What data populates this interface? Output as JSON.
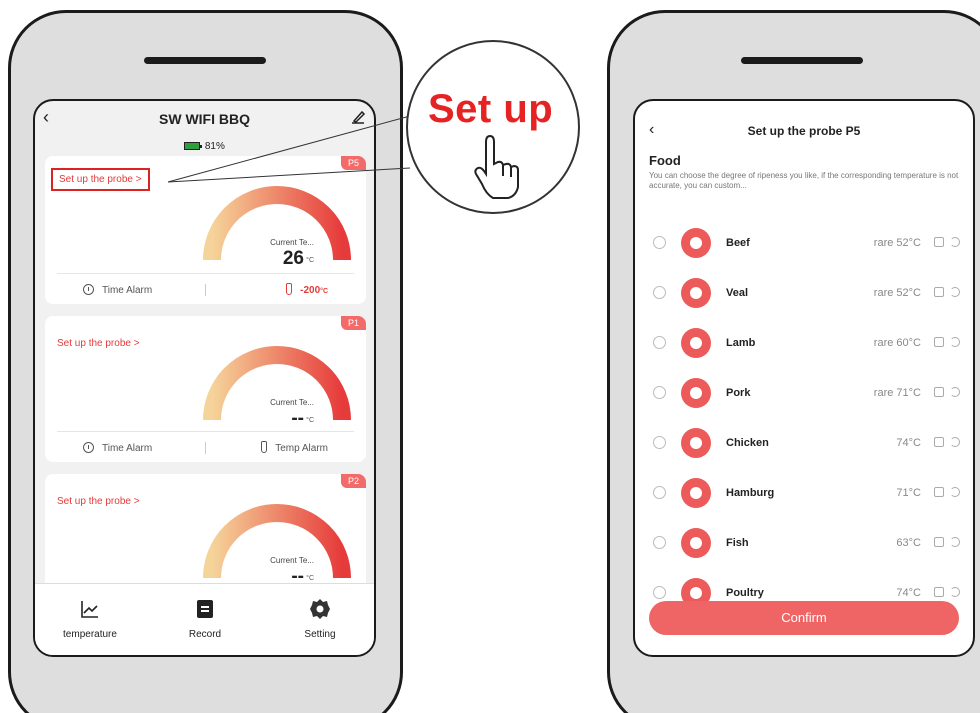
{
  "left_app": {
    "title": "SW WIFI BBQ",
    "battery": "81%",
    "cards": [
      {
        "probe": "P5",
        "setup_label": "Set up the probe >",
        "gauge_label": "Current Te...",
        "current_temp": "26",
        "unit": "°C",
        "time_alarm": "Time Alarm",
        "temp_alarm": "-200",
        "temp_alarm_unit": "°C"
      },
      {
        "probe": "P1",
        "setup_label": "Set up the probe >",
        "gauge_label": "Current Te...",
        "current_temp": "--",
        "unit": "°C",
        "time_alarm": "Time Alarm",
        "temp_alarm": "Temp Alarm"
      },
      {
        "probe": "P2",
        "setup_label": "Set up the probe >",
        "gauge_label": "Current Te...",
        "current_temp": "--",
        "unit": "°C"
      }
    ],
    "nav": [
      {
        "label": "temperature",
        "icon": "chart-icon"
      },
      {
        "label": "Record",
        "icon": "record-icon"
      },
      {
        "label": "Setting",
        "icon": "gear-icon"
      }
    ]
  },
  "callout": {
    "text": "Set up"
  },
  "right_app": {
    "title": "Set up the probe P5",
    "section_title": "Food",
    "description": "You can choose the degree of ripeness you like, if the corresponding temperature is not accurate, you can custom...",
    "items": [
      {
        "name": "Beef",
        "temp": "rare 52°C"
      },
      {
        "name": "Veal",
        "temp": "rare 52°C"
      },
      {
        "name": "Lamb",
        "temp": "rare 60°C"
      },
      {
        "name": "Pork",
        "temp": "rare 71°C"
      },
      {
        "name": "Chicken",
        "temp": "74°C"
      },
      {
        "name": "Hamburg",
        "temp": "71°C"
      },
      {
        "name": "Fish",
        "temp": "63°C"
      },
      {
        "name": "Poultry",
        "temp": "74°C"
      }
    ],
    "confirm_label": "Confirm"
  },
  "colors": {
    "accent": "#ec5a5a",
    "highlight": "#d22222",
    "phone_body": "#dedede"
  }
}
